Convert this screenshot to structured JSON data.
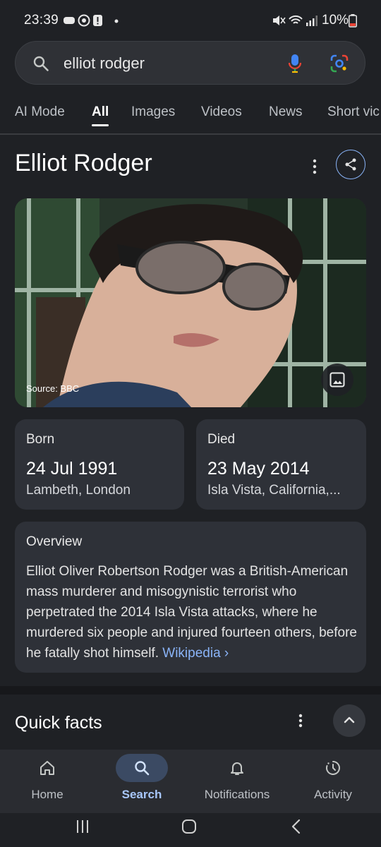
{
  "status_bar": {
    "time": "23:39",
    "battery": "10%"
  },
  "search": {
    "query": "elliot rodger"
  },
  "tabs": [
    {
      "label": "AI Mode"
    },
    {
      "label": "All"
    },
    {
      "label": "Images"
    },
    {
      "label": "Videos"
    },
    {
      "label": "News"
    },
    {
      "label": "Short vic"
    }
  ],
  "entity": {
    "title": "Elliot Rodger",
    "image_source": "Source: BBC"
  },
  "born": {
    "label": "Born",
    "date": "24 Jul 1991",
    "place": "Lambeth, London"
  },
  "died": {
    "label": "Died",
    "date": "23 May 2014",
    "place": "Isla Vista, California,..."
  },
  "overview": {
    "label": "Overview",
    "text": "Elliot Oliver Robertson Rodger was a British-American mass murderer and misogynistic terrorist who perpetrated the 2014 Isla Vista attacks, where he murdered six people and injured fourteen others, before he fatally shot himself.",
    "link": "Wikipedia ›"
  },
  "quick_facts": {
    "title": "Quick facts"
  },
  "bottom_nav": [
    {
      "label": "Home",
      "icon": "home-icon"
    },
    {
      "label": "Search",
      "icon": "search-icon"
    },
    {
      "label": "Notifications",
      "icon": "bell-icon"
    },
    {
      "label": "Activity",
      "icon": "activity-icon"
    }
  ],
  "colors": {
    "background": "#1f2125",
    "accent": "#8ab4f8",
    "card": "#2e3138"
  }
}
